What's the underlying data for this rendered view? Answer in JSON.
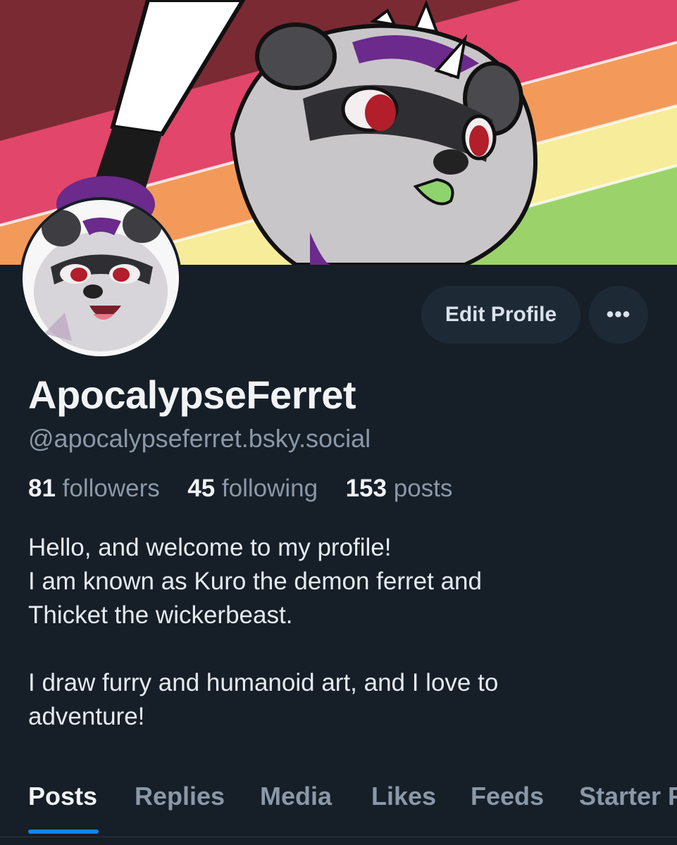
{
  "profile": {
    "display_name": "ApocalypseFerret",
    "handle": "@apocalypseferret.bsky.social"
  },
  "actions": {
    "edit_label": "Edit Profile",
    "more_label": "•••"
  },
  "stats": {
    "followers_count": "81",
    "followers_label": "followers",
    "following_count": "45",
    "following_label": "following",
    "posts_count": "153",
    "posts_label": "posts"
  },
  "bio": {
    "lines": [
      "Hello, and welcome to my profile!",
      "I am known as Kuro the demon ferret and",
      "Thicket the wickerbeast.",
      "",
      "I draw furry and humanoid art, and I love to",
      "adventure!"
    ]
  },
  "tabs": [
    {
      "label": "Posts"
    },
    {
      "label": "Replies"
    },
    {
      "label": "Media"
    },
    {
      "label": "Likes"
    },
    {
      "label": "Feeds"
    },
    {
      "label": "Starter Packs"
    }
  ],
  "colors": {
    "background": "#161e27",
    "accent": "#1083fe",
    "muted_text": "#8a98a8",
    "button_bg": "#1e2936"
  },
  "icons": {
    "more": "ellipsis-icon"
  }
}
